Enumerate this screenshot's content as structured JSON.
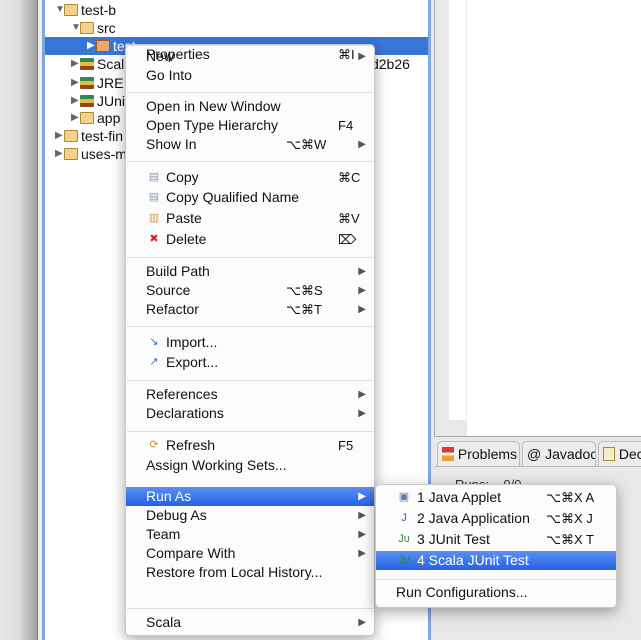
{
  "tree": {
    "items": [
      {
        "label": "test-b",
        "expanded": true,
        "icon": "scala-project-folder-icon",
        "level": 0
      },
      {
        "label": "src",
        "expanded": true,
        "icon": "source-folder-icon",
        "level": 1
      },
      {
        "label": "test",
        "expanded": false,
        "icon": "package-icon",
        "level": 2,
        "selected": true
      },
      {
        "label": "Scala Library [2.10.0-20121205-210653-43cd2b26",
        "expanded": false,
        "icon": "library-icon",
        "level": 1
      },
      {
        "label": "JRE System Library [JavaSE-1.6]",
        "expanded": false,
        "icon": "library-icon",
        "level": 1
      },
      {
        "label": "JUnit 4",
        "expanded": false,
        "icon": "library-icon",
        "level": 1
      },
      {
        "label": "app",
        "expanded": false,
        "icon": "folder-icon",
        "level": 1
      },
      {
        "label": "test-fin",
        "expanded": false,
        "icon": "java-project-folder-icon",
        "level": 0
      },
      {
        "label": "uses-m",
        "expanded": false,
        "icon": "scala-project-folder-icon",
        "level": 0
      }
    ]
  },
  "bottom_panel": {
    "tabs": [
      {
        "label": "Problems",
        "icon": "problems-icon"
      },
      {
        "label": "@ Javadoc",
        "icon": "javadoc-icon"
      },
      {
        "label": "Dec",
        "icon": "declaration-icon"
      }
    ],
    "runs_label": "Runs:",
    "runs_value": "0/0"
  },
  "context_menu": {
    "items": [
      {
        "label": "New",
        "submenu": true
      },
      {
        "label": "Go Into"
      },
      {
        "sep": true
      },
      {
        "label": "Open in New Window"
      },
      {
        "label": "Open Type Hierarchy",
        "shortcut": "F4"
      },
      {
        "label": "Show In",
        "shortcut": "⌥⌘W",
        "submenu": true
      },
      {
        "sep": true
      },
      {
        "label": "Copy",
        "shortcut": "⌘C",
        "icon": "copy-icon"
      },
      {
        "label": "Copy Qualified Name",
        "icon": "copy-qualified-name-icon"
      },
      {
        "label": "Paste",
        "shortcut": "⌘V",
        "icon": "paste-icon"
      },
      {
        "label": "Delete",
        "shortcut": "⌦",
        "icon": "delete-icon"
      },
      {
        "sep": true
      },
      {
        "label": "Build Path",
        "submenu": true
      },
      {
        "label": "Source",
        "shortcut": "⌥⌘S",
        "submenu": true
      },
      {
        "label": "Refactor",
        "shortcut": "⌥⌘T",
        "submenu": true
      },
      {
        "sep": true
      },
      {
        "label": "Import...",
        "icon": "import-icon"
      },
      {
        "label": "Export...",
        "icon": "export-icon"
      },
      {
        "sep": true
      },
      {
        "label": "References",
        "submenu": true
      },
      {
        "label": "Declarations",
        "submenu": true
      },
      {
        "sep": true
      },
      {
        "label": "Refresh",
        "shortcut": "F5",
        "icon": "refresh-icon"
      },
      {
        "label": "Assign Working Sets..."
      },
      {
        "sep": true
      },
      {
        "label": "Run As",
        "submenu": true,
        "highlighted": true
      },
      {
        "label": "Debug As",
        "submenu": true
      },
      {
        "label": "Team",
        "submenu": true
      },
      {
        "label": "Compare With",
        "submenu": true
      },
      {
        "label": "Restore from Local History..."
      },
      {
        "label": "Scala",
        "submenu": true
      },
      {
        "sep": true
      },
      {
        "label": "Properties",
        "shortcut": "⌘I"
      }
    ]
  },
  "run_as_submenu": {
    "items": [
      {
        "label": "1 Java Applet",
        "shortcut": "⌥⌘X A",
        "icon": "java-applet-icon"
      },
      {
        "label": "2 Java Application",
        "shortcut": "⌥⌘X J",
        "icon": "java-application-icon"
      },
      {
        "label": "3 JUnit Test",
        "shortcut": "⌥⌘X T",
        "icon": "junit-icon"
      },
      {
        "label": "4 Scala JUnit Test",
        "icon": "scala-junit-icon",
        "highlighted": true
      },
      {
        "sep": true
      },
      {
        "label": "Run Configurations..."
      }
    ]
  },
  "colors": {
    "selection": "#3875d7",
    "menu_highlight": "#2f6ced",
    "view_border": "#7ea6e0"
  }
}
